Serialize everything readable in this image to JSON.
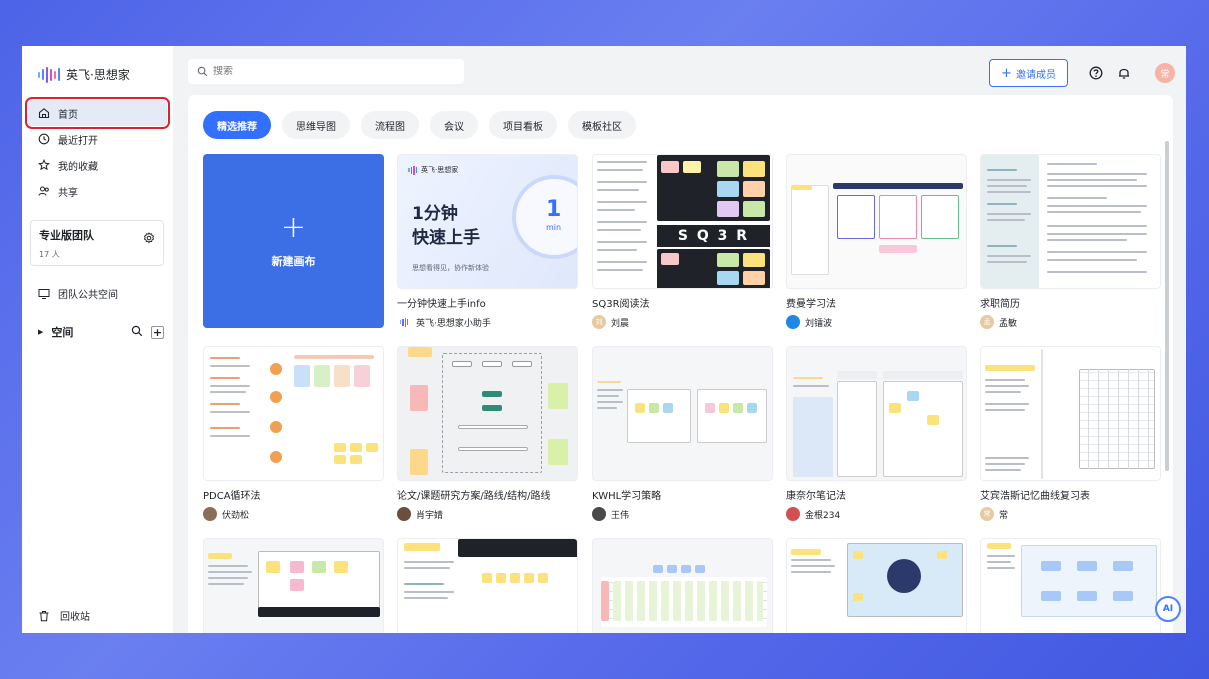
{
  "app": {
    "name": "英飞·思想家"
  },
  "sidebar": {
    "items": [
      {
        "label": "首页",
        "icon": "home-icon"
      },
      {
        "label": "最近打开",
        "icon": "clock-icon"
      },
      {
        "label": "我的收藏",
        "icon": "star-icon"
      },
      {
        "label": "共享",
        "icon": "share-icon"
      }
    ],
    "team": {
      "name": "专业版团队",
      "count": "17 人"
    },
    "public_space": "团队公共空间",
    "space": "空间",
    "trash": "回收站"
  },
  "header": {
    "search_placeholder": "搜索",
    "invite_label": "邀请成员",
    "user_avatar": "常"
  },
  "tabs": [
    "精选推荐",
    "思维导图",
    "流程图",
    "会议",
    "项目看板",
    "模板社区"
  ],
  "new_canvas": "新建画布",
  "templates": [
    {
      "title": "一分钟快速上手info",
      "author": "英飞·思想家小助手",
      "avatar": "",
      "avatar_color": "#ffffff"
    },
    {
      "title": "SQ3R阅读法",
      "author": "刘晨",
      "avatar": "刘",
      "avatar_color": "#e8c9a0"
    },
    {
      "title": "费曼学习法",
      "author": "刘镭波",
      "avatar": "",
      "avatar_color": "#1e88e5"
    },
    {
      "title": "求职简历",
      "author": "孟敏",
      "avatar": "孟",
      "avatar_color": "#e8c9a0"
    },
    {
      "title": "PDCA循环法",
      "author": "伏劲松",
      "avatar": "",
      "avatar_color": "#8a6d5a"
    },
    {
      "title": "论文/课题研究方案/路线/结构/路线",
      "author": "肖宇婧",
      "avatar": "",
      "avatar_color": "#6b4e3d"
    },
    {
      "title": "KWHL学习策略",
      "author": "王伟",
      "avatar": "",
      "avatar_color": "#4a4a4a"
    },
    {
      "title": "康奈尔笔记法",
      "author": "金根234",
      "avatar": "",
      "avatar_color": "#d45050"
    },
    {
      "title": "艾宾浩斯记忆曲线复习表",
      "author": "常",
      "avatar": "常",
      "avatar_color": "#e8c9a0"
    }
  ],
  "quickstart": {
    "brand": "英飞·思想家",
    "headline_1": "1分钟",
    "headline_2": "快速上手",
    "tagline": "思想看得见，协作新体验",
    "clock_number": "1",
    "clock_unit": "min"
  },
  "sq3r_banner": "S Q 3 R",
  "ai_label": "AI",
  "colors": {
    "accent": "#3370ff",
    "new_card": "#3c6ee6",
    "highlight": "#e0202a"
  }
}
